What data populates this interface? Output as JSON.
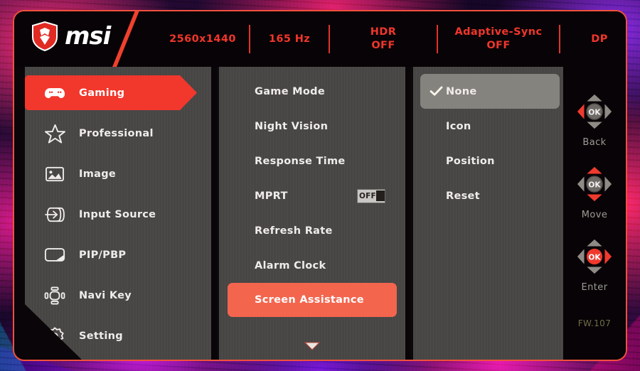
{
  "brand": {
    "name": "msi",
    "logo_icon": "msi-dragon-shield-icon"
  },
  "header": {
    "status": [
      {
        "id": "resolution",
        "text": "2560x1440"
      },
      {
        "id": "refresh",
        "text": "165 Hz"
      },
      {
        "id": "hdr",
        "text": "HDR\nOFF"
      },
      {
        "id": "adaptive_sync",
        "text": "Adaptive-Sync\nOFF"
      },
      {
        "id": "input",
        "text": "DP"
      }
    ],
    "accent_color": "#f0362c"
  },
  "sidebar": {
    "items": [
      {
        "label": "Gaming",
        "icon": "gamepad-icon",
        "active": true
      },
      {
        "label": "Professional",
        "icon": "star-icon",
        "active": false
      },
      {
        "label": "Image",
        "icon": "picture-icon",
        "active": false
      },
      {
        "label": "Input Source",
        "icon": "input-arrow-icon",
        "active": false
      },
      {
        "label": "PIP/PBP",
        "icon": "pip-pbp-icon",
        "active": false
      },
      {
        "label": "Navi Key",
        "icon": "navi-key-icon",
        "active": false
      },
      {
        "label": "Setting",
        "icon": "gear-icon",
        "active": false
      }
    ]
  },
  "submenu": {
    "items": [
      {
        "label": "Game Mode",
        "selected": false,
        "toggle": null
      },
      {
        "label": "Night Vision",
        "selected": false,
        "toggle": null
      },
      {
        "label": "Response Time",
        "selected": false,
        "toggle": null
      },
      {
        "label": "MPRT",
        "selected": false,
        "toggle": "OFF"
      },
      {
        "label": "Refresh Rate",
        "selected": false,
        "toggle": null
      },
      {
        "label": "Alarm Clock",
        "selected": false,
        "toggle": null
      },
      {
        "label": "Screen Assistance",
        "selected": true,
        "toggle": null
      }
    ],
    "scroll_more_icon": "chevron-down-icon",
    "highlight_color": "#f4654e"
  },
  "values": {
    "items": [
      {
        "label": "None",
        "checked": true
      },
      {
        "label": "Icon",
        "checked": false
      },
      {
        "label": "Position",
        "checked": false
      },
      {
        "label": "Reset",
        "checked": false
      }
    ],
    "check_icon": "checkmark-icon",
    "highlight_color": "#85837e"
  },
  "nav_hints": {
    "items": [
      {
        "label": "Back",
        "icon": "dpad-left-icon"
      },
      {
        "label": "Move",
        "icon": "dpad-updown-icon"
      },
      {
        "label": "Enter",
        "icon": "dpad-ok-right-icon"
      }
    ],
    "firmware": "FW.107"
  }
}
